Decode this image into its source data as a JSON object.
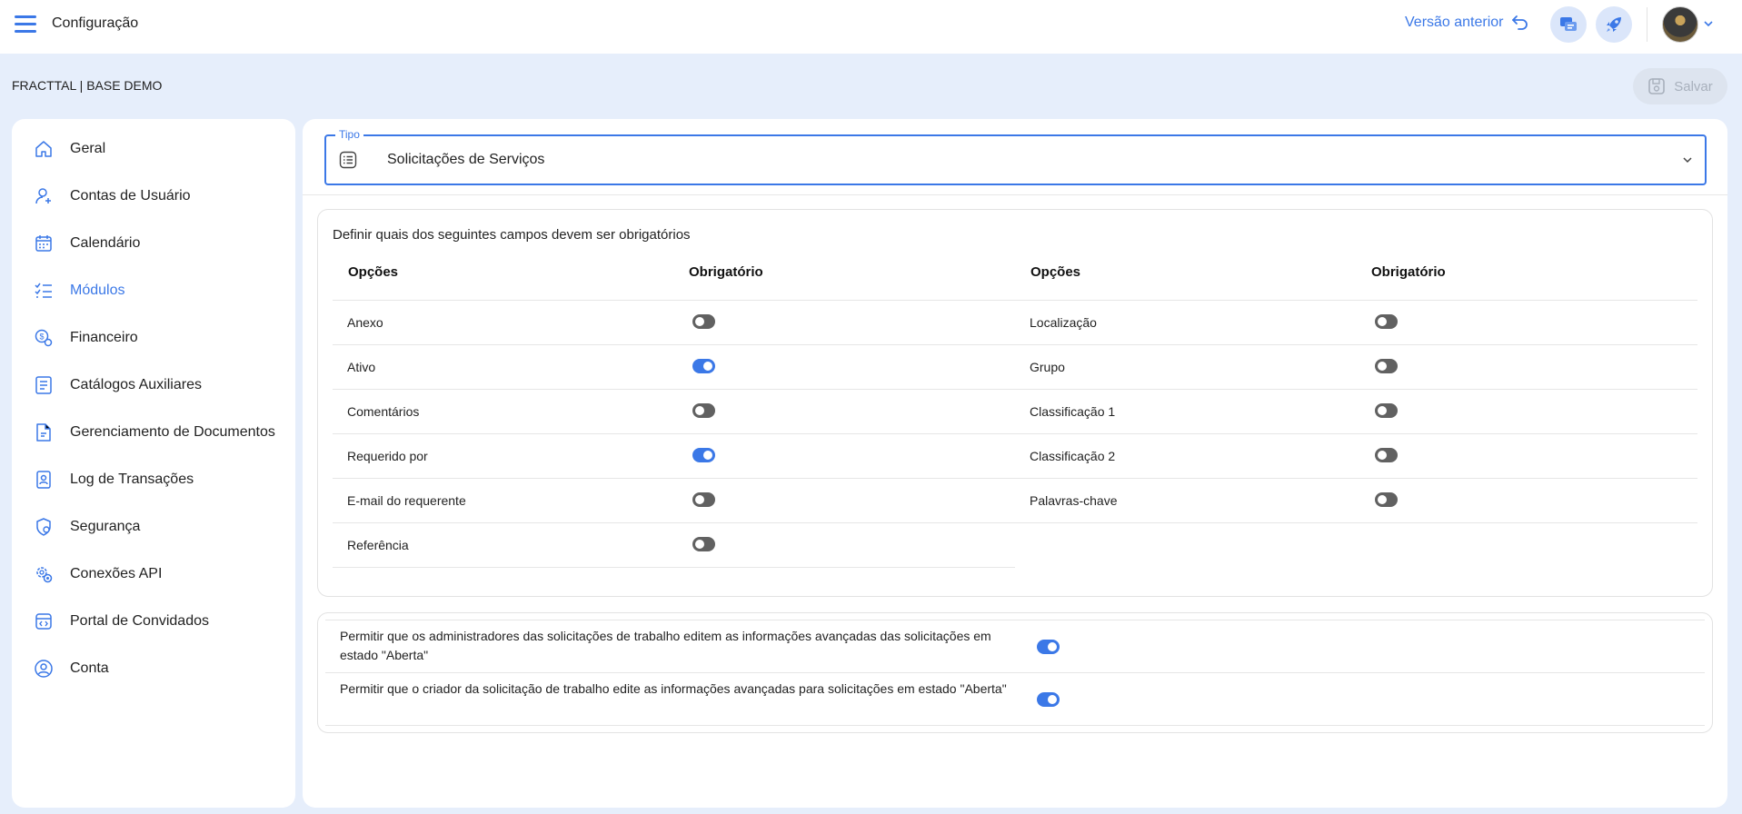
{
  "header": {
    "title": "Configuração",
    "prev_version": "Versão anterior"
  },
  "subheader": {
    "company": "FRACTTAL | BASE DEMO",
    "save_label": "Salvar"
  },
  "sidebar": {
    "items": [
      {
        "label": "Geral",
        "icon": "home-icon",
        "active": false
      },
      {
        "label": "Contas de Usuário",
        "icon": "user-add-icon",
        "active": false
      },
      {
        "label": "Calendário",
        "icon": "calendar-icon",
        "active": false
      },
      {
        "label": "Módulos",
        "icon": "checklist-icon",
        "active": true
      },
      {
        "label": "Financeiro",
        "icon": "money-icon",
        "active": false
      },
      {
        "label": "Catálogos Auxiliares",
        "icon": "catalog-icon",
        "active": false
      },
      {
        "label": "Gerenciamento de Documentos",
        "icon": "document-icon",
        "active": false
      },
      {
        "label": "Log de Transações",
        "icon": "log-icon",
        "active": false
      },
      {
        "label": "Segurança",
        "icon": "shield-icon",
        "active": false
      },
      {
        "label": "Conexões API",
        "icon": "api-gear-icon",
        "active": false
      },
      {
        "label": "Portal de Convidados",
        "icon": "portal-icon",
        "active": false
      },
      {
        "label": "Conta",
        "icon": "account-icon",
        "active": false
      }
    ]
  },
  "main": {
    "tipo_label": "Tipo",
    "tipo_value": "Solicitações de Serviços",
    "required_title": "Definir quais dos seguintes campos devem ser obrigatórios",
    "col_options": "Opções",
    "col_required": "Obrigatório",
    "left_rows": [
      {
        "label": "Anexo",
        "on": false
      },
      {
        "label": "Ativo",
        "on": true
      },
      {
        "label": "Comentários",
        "on": false
      },
      {
        "label": "Requerido por",
        "on": true
      },
      {
        "label": "E-mail do requerente",
        "on": false
      },
      {
        "label": "Referência",
        "on": false
      }
    ],
    "right_rows": [
      {
        "label": "Localização",
        "on": false
      },
      {
        "label": "Grupo",
        "on": false
      },
      {
        "label": "Classificação 1",
        "on": false
      },
      {
        "label": "Classificação 2",
        "on": false
      },
      {
        "label": "Palavras-chave",
        "on": false
      }
    ],
    "permissions": [
      {
        "label": "Permitir que os administradores das solicitações de trabalho editem as informações avançadas das solicitações em estado \"Aberta\"",
        "on": true
      },
      {
        "label": "Permitir que o criador da solicitação de trabalho edite as informações avançadas para solicitações em estado \"Aberta\"",
        "on": true
      }
    ]
  },
  "colors": {
    "accent": "#3b78e7",
    "background": "#e6eefb",
    "toggle_off": "#616161"
  }
}
